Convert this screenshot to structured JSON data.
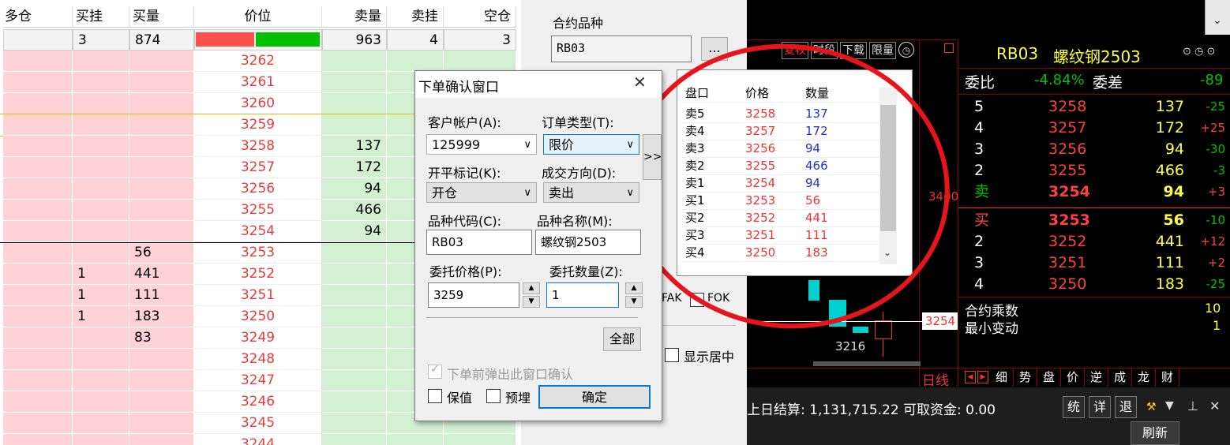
{
  "ladder": {
    "headers": [
      "多仓",
      "买挂",
      "买量",
      "价位",
      "卖量",
      "卖挂",
      "空仓"
    ],
    "top_row": {
      "buy_orders": "3",
      "buy_volume": "874",
      "sell_volume": "963",
      "sell_orders": "4",
      "short_pos": "3"
    },
    "rows": [
      {
        "price": "3262",
        "sell_vol": "",
        "buy_hang": "",
        "buy_vol": "",
        "tag": ""
      },
      {
        "price": "3261",
        "sell_vol": "",
        "buy_hang": "",
        "buy_vol": "",
        "tag": ""
      },
      {
        "price": "3260",
        "sell_vol": "",
        "buy_hang": "",
        "buy_vol": "",
        "tag": ""
      },
      {
        "price": "3259",
        "sell_vol": "",
        "buy_hang": "",
        "buy_vol": "",
        "tag": ""
      },
      {
        "price": "3258",
        "sell_vol": "137",
        "buy_hang": "",
        "buy_vol": "",
        "tag": ""
      },
      {
        "price": "3257",
        "sell_vol": "172",
        "buy_hang": "",
        "buy_vol": "",
        "tag": ""
      },
      {
        "price": "3256",
        "sell_vol": "94",
        "buy_hang": "",
        "buy_vol": "",
        "tag": ""
      },
      {
        "price": "3255",
        "sell_vol": "466",
        "buy_hang": "",
        "buy_vol": "",
        "tag": ""
      },
      {
        "price": "3254",
        "sell_vol": "94",
        "buy_hang": "",
        "buy_vol": "",
        "tag": "卖"
      },
      {
        "price": "3253",
        "sell_vol": "",
        "buy_hang": "",
        "buy_vol": "56",
        "tag": "买"
      },
      {
        "price": "3252",
        "sell_vol": "",
        "buy_hang": "1",
        "buy_vol": "441",
        "tag": ""
      },
      {
        "price": "3251",
        "sell_vol": "",
        "buy_hang": "1",
        "buy_vol": "111",
        "tag": ""
      },
      {
        "price": "3250",
        "sell_vol": "",
        "buy_hang": "1",
        "buy_vol": "183",
        "tag": ""
      },
      {
        "price": "3249",
        "sell_vol": "",
        "buy_hang": "",
        "buy_vol": "83",
        "tag": ""
      },
      {
        "price": "3248",
        "sell_vol": "",
        "buy_hang": "",
        "buy_vol": "",
        "tag": ""
      },
      {
        "price": "3247",
        "sell_vol": "",
        "buy_hang": "",
        "buy_vol": "",
        "tag": ""
      },
      {
        "price": "3246",
        "sell_vol": "",
        "buy_hang": "",
        "buy_vol": "",
        "tag": ""
      },
      {
        "price": "3245",
        "sell_vol": "",
        "buy_hang": "",
        "buy_vol": "",
        "tag": ""
      },
      {
        "price": "3244",
        "sell_vol": "",
        "buy_hang": "",
        "buy_vol": "",
        "tag": ""
      }
    ]
  },
  "mid": {
    "contract_label": "合约品种",
    "contract_value": "RB03",
    "browse_label": "...",
    "fak": "FAK",
    "fok": "FOK",
    "center_label": "显示居中"
  },
  "dialog": {
    "title": "下单确认窗口",
    "account_label": "客户帐户(A):",
    "account_value": "125999",
    "order_type_label": "订单类型(T):",
    "order_type_value": "限价",
    "openclose_label": "开平标记(K):",
    "openclose_value": "开仓",
    "direction_label": "成交方向(D):",
    "direction_value": "卖出",
    "code_label": "品种代码(C):",
    "code_value": "RB03",
    "name_label": "品种名称(M):",
    "name_value": "螺纹钢2503",
    "price_label": "委托价格(P):",
    "price_value": "3259",
    "qty_label": "委托数量(Z):",
    "qty_value": "1",
    "all_button": "全部",
    "confirm_popup_label": "下单前弹出此窗口确认",
    "hedge_label": "保值",
    "preset_label": "预埋",
    "ok_button": "确定",
    "expand": ">>"
  },
  "popup": {
    "headers": [
      "盘口",
      "价格",
      "数量"
    ],
    "rows": [
      {
        "side": "卖5",
        "price": "3258",
        "qty": "137"
      },
      {
        "side": "卖4",
        "price": "3257",
        "qty": "172"
      },
      {
        "side": "卖3",
        "price": "3256",
        "qty": "94"
      },
      {
        "side": "卖2",
        "price": "3255",
        "qty": "466"
      },
      {
        "side": "卖1",
        "price": "3254",
        "qty": "94"
      },
      {
        "side": "买1",
        "price": "3253",
        "qty": "56"
      },
      {
        "side": "买2",
        "price": "3252",
        "qty": "441"
      },
      {
        "side": "买3",
        "price": "3251",
        "qty": "111"
      },
      {
        "side": "买4",
        "price": "3250",
        "qty": "183"
      }
    ]
  },
  "chart": {
    "toolbar": [
      "复权",
      "时段",
      "下载",
      "限量"
    ],
    "price_tag_1": "3400",
    "price_tag_2": "3254",
    "low_label": "3216",
    "bottom_left": "日线",
    "bottom_tabs": [
      "细",
      "势",
      "盘",
      "价",
      "逆",
      "成",
      "龙",
      "财"
    ]
  },
  "quote": {
    "code": "RB03",
    "name": "螺纹钢2503",
    "weibi_label": "委比",
    "weibi_value": "-4.84%",
    "weicha_label": "委差",
    "weicha_value": "-89",
    "asks": [
      {
        "level": "5",
        "price": "3258",
        "vol": "137",
        "chg": "-25"
      },
      {
        "level": "4",
        "price": "3257",
        "vol": "172",
        "chg": "+25"
      },
      {
        "level": "3",
        "price": "3256",
        "vol": "94",
        "chg": "-30"
      },
      {
        "level": "2",
        "price": "3255",
        "vol": "466",
        "chg": "-3"
      },
      {
        "level": "卖",
        "price": "3254",
        "vol": "94",
        "chg": "+3"
      }
    ],
    "bids": [
      {
        "level": "买",
        "price": "3253",
        "vol": "56",
        "chg": "-10"
      },
      {
        "level": "2",
        "price": "3252",
        "vol": "441",
        "chg": "+12"
      },
      {
        "level": "3",
        "price": "3251",
        "vol": "111",
        "chg": "+2"
      },
      {
        "level": "4",
        "price": "3250",
        "vol": "183",
        "chg": "-25"
      }
    ],
    "multiplier_label": "合约乘数",
    "multiplier_value": "10",
    "tick_label": "最小变动",
    "tick_value": "1"
  },
  "status": {
    "settlement": "上日结算: 1,131,715.22",
    "funds": "可取资金: 0.00",
    "buttons": [
      "统",
      "详",
      "退"
    ],
    "refresh": "刷新"
  }
}
